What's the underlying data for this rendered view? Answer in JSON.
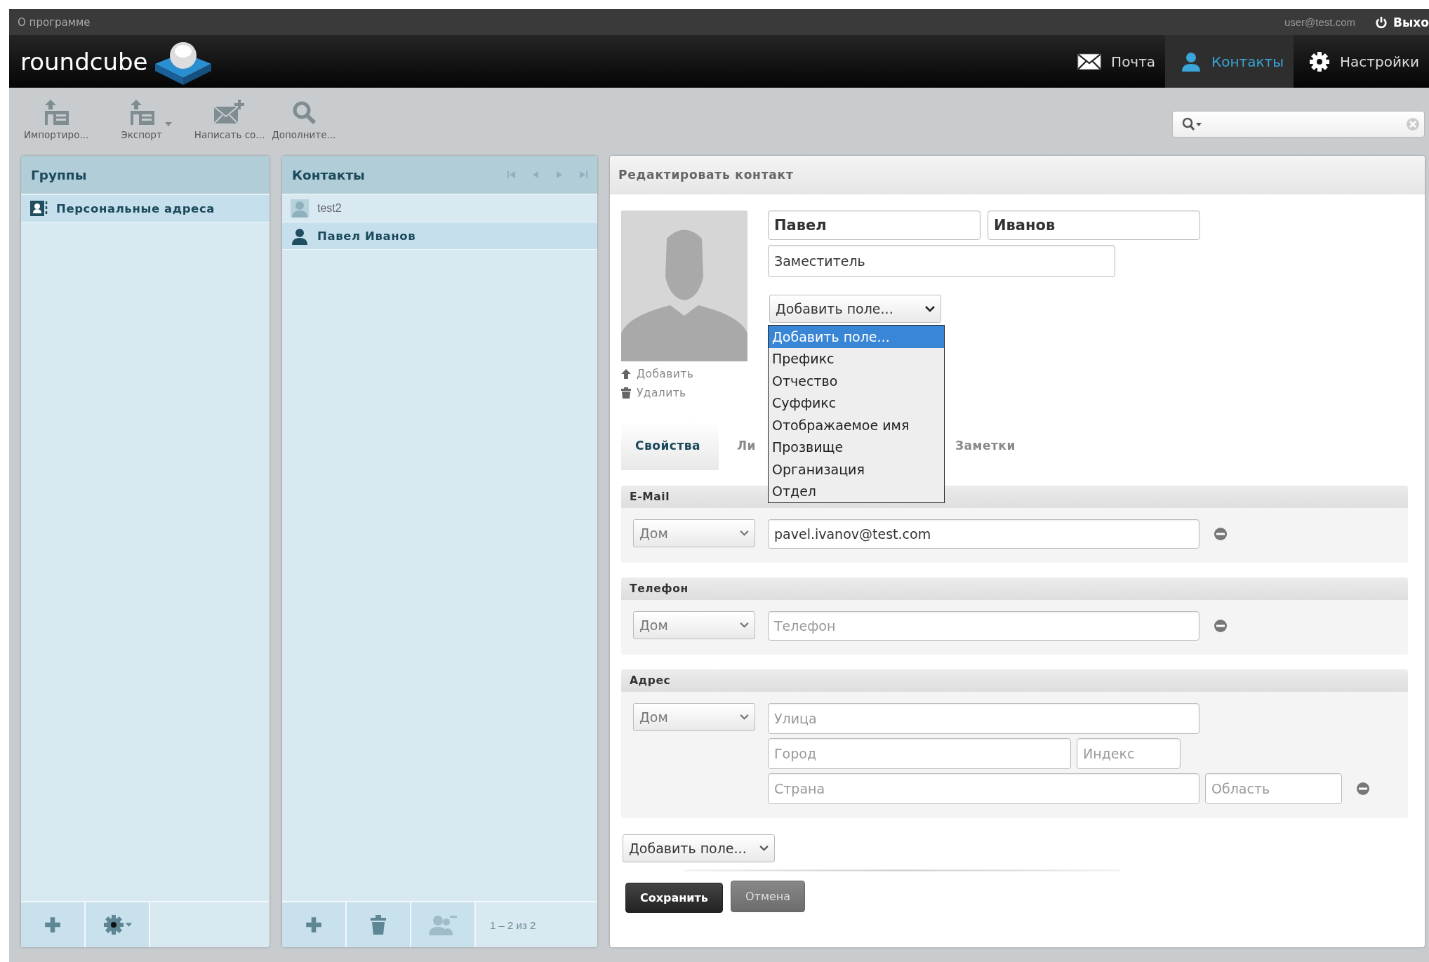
{
  "top_bar": {
    "about_link": "О программе",
    "user": "user@test.com",
    "logout": "Выхо"
  },
  "header": {
    "logo": "roundcube",
    "nav": [
      {
        "label": "Почта",
        "kind": "mail",
        "selected": false
      },
      {
        "label": "Контакты",
        "kind": "person",
        "selected": true
      },
      {
        "label": "Настройки",
        "kind": "gear",
        "selected": false
      }
    ]
  },
  "toolbar": {
    "buttons": [
      {
        "label": "Импортиро...",
        "kind": "import"
      },
      {
        "label": "Экспорт",
        "kind": "export"
      },
      {
        "label": "Написать со...",
        "kind": "compose"
      },
      {
        "label": "Дополните...",
        "kind": "search"
      }
    ]
  },
  "groups": {
    "title": "Группы",
    "items": [
      {
        "label": "Персональные адреса",
        "selected": true
      }
    ]
  },
  "contacts": {
    "title": "Контакты",
    "items": [
      {
        "name": "test2",
        "selected": false
      },
      {
        "name": "Павел Иванов",
        "selected": true
      }
    ],
    "count": "1 – 2 из 2"
  },
  "editor": {
    "title": "Редактировать контакт",
    "first_name": "Павел",
    "last_name": "Иванов",
    "job_title": "Заместитель",
    "add_field_select": "Добавить поле...",
    "dropdown": {
      "options": [
        {
          "label": "Добавить поле...",
          "selected": true
        },
        {
          "label": "Префикс",
          "selected": false
        },
        {
          "label": "Отчество",
          "selected": false
        },
        {
          "label": "Суффикс",
          "selected": false
        },
        {
          "label": "Отображаемое имя",
          "selected": false
        },
        {
          "label": "Прозвище",
          "selected": false
        },
        {
          "label": "Организация",
          "selected": false
        },
        {
          "label": "Отдел",
          "selected": false
        }
      ]
    },
    "photo_actions": [
      {
        "label": "Добавить",
        "kind": "upload"
      },
      {
        "label": "Удалить",
        "kind": "trash"
      }
    ],
    "tabs": [
      {
        "label": "Свойства",
        "selected": true
      },
      {
        "label": "Ли",
        "selected": false
      },
      {
        "label": "Заметки",
        "selected": false
      }
    ],
    "sections": [
      {
        "title": "E-Mail",
        "type_select": "Дом",
        "rows": [
          [
            {
              "kind": "wide",
              "value": "pavel.ivanov@test.com"
            }
          ]
        ]
      },
      {
        "title": "Телефон",
        "type_select": "Дом",
        "rows": [
          [
            {
              "kind": "wide",
              "placeholder": "Телефон"
            }
          ]
        ]
      },
      {
        "title": "Адрес",
        "type_select": "Дом",
        "rows": [
          [
            {
              "kind": "wide",
              "placeholder": "Улица"
            }
          ],
          [
            {
              "kind": "city",
              "placeholder": "Город"
            },
            {
              "kind": "zip",
              "placeholder": "Индекс"
            }
          ],
          [
            {
              "kind": "wide",
              "placeholder": "Страна"
            },
            {
              "kind": "region",
              "placeholder": "Область"
            }
          ]
        ]
      }
    ],
    "add_field_bottom": "Добавить поле...",
    "buttons": [
      {
        "label": "Сохранить",
        "kind": "primary"
      },
      {
        "label": "Отмена",
        "kind": "secondary"
      }
    ]
  }
}
